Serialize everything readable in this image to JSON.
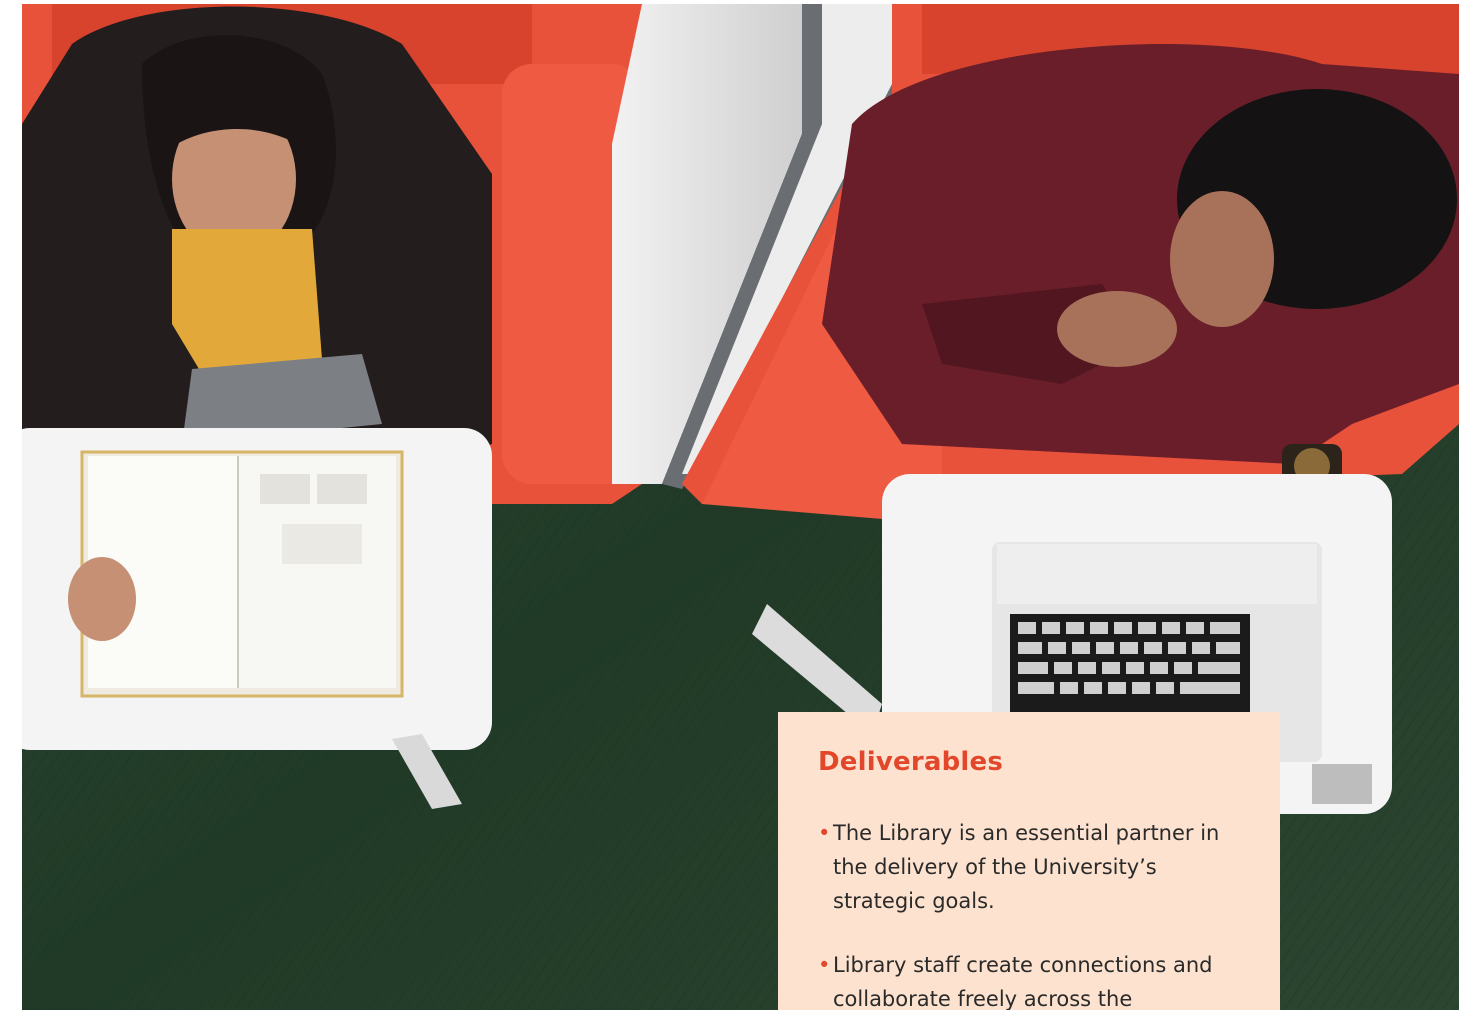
{
  "colors": {
    "accent": "#e2472b",
    "callout_background": "#fde3cf",
    "body_text": "#2a2a2a",
    "sofa_red": "#e8513a",
    "carpet_green": "#263f2b"
  },
  "photo": {
    "subject": "overhead-photo-students-studying"
  },
  "callout": {
    "heading": "Deliverables",
    "bullet_glyph": "•",
    "items": [
      {
        "text": "The Library is an essential partner in the delivery of the University’s strategic goals."
      },
      {
        "text": "Library staff create connections and collaborate freely across the"
      }
    ]
  }
}
